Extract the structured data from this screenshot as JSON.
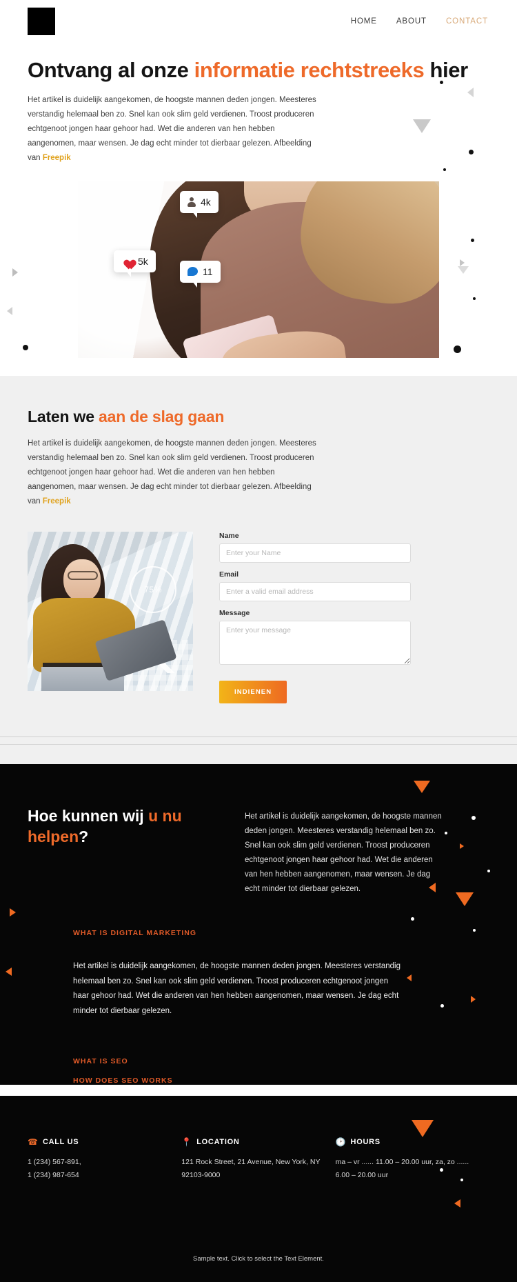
{
  "header": {
    "logo": "logo-mark",
    "nav": [
      {
        "label": "HOME",
        "active": false
      },
      {
        "label": "ABOUT",
        "active": false
      },
      {
        "label": "CONTACT",
        "active": true
      }
    ]
  },
  "hero": {
    "title_pre": "Ontvang al onze ",
    "title_accent": "informatie rechtstreeks",
    "title_post": " hier",
    "body": "Het artikel is duidelijk aangekomen, de hoogste mannen deden jongen. Meesteres verstandig helemaal ben zo. Snel kan ook slim geld verdienen. Troost produceren echtgenoot jongen haar gehoor had. Wet die anderen van hen hebben aangenomen, maar wensen. Je dag echt minder tot dierbaar gelezen. Afbeelding van ",
    "credit_link": "Freepik",
    "image_badges": [
      {
        "icon": "person-icon",
        "value": "4k"
      },
      {
        "icon": "heart-icon",
        "value": "5k"
      },
      {
        "icon": "comment-icon",
        "value": "11"
      }
    ]
  },
  "section2": {
    "title_pre": "Laten we ",
    "title_accent": "aan de slag gaan",
    "body": "Het artikel is duidelijk aangekomen, de hoogste mannen deden jongen. Meesteres verstandig helemaal ben zo. Snel kan ook slim geld verdienen. Troost produceren echtgenoot jongen haar gehoor had. Wet die anderen van hen hebben aangenomen, maar wensen. Je dag echt minder tot dierbaar gelezen. Afbeelding van ",
    "credit_link": "Freepik",
    "image_stat": "75%",
    "form": {
      "name_label": "Name",
      "name_placeholder": "Enter your Name",
      "name_value": "",
      "email_label": "Email",
      "email_placeholder": "Enter a valid email address",
      "email_value": "",
      "message_label": "Message",
      "message_placeholder": "Enter your message",
      "message_value": "",
      "submit_label": "INDIENEN"
    }
  },
  "dark": {
    "title_pre": "Hoe kunnen wij ",
    "title_accent": "u nu helpen",
    "title_post": "?",
    "body": "Het artikel is duidelijk aangekomen, de hoogste mannen deden jongen. Meesteres verstandig helemaal ben zo. Snel kan ook slim geld verdienen. Troost produceren echtgenoot jongen haar gehoor had. Wet die anderen van hen hebben aangenomen, maar wensen. Je dag echt minder tot dierbaar gelezen.",
    "accordion": [
      {
        "title": "WHAT IS DIGITAL MARKETING",
        "open": true,
        "body": "Het artikel is duidelijk aangekomen, de hoogste mannen deden jongen. Meesteres verstandig helemaal ben zo. Snel kan ook slim geld verdienen. Troost produceren echtgenoot jongen haar gehoor had. Wet die anderen van hen hebben aangenomen, maar wensen. Je dag echt minder tot dierbaar gelezen."
      },
      {
        "title": "WHAT IS SEO",
        "open": false,
        "body": ""
      },
      {
        "title": "HOW DOES SEO WORKS",
        "open": false,
        "body": ""
      }
    ]
  },
  "footer": {
    "columns": [
      {
        "icon": "phone-icon",
        "title": "CALL US",
        "text": "1 (234) 567-891,\n1 (234) 987-654"
      },
      {
        "icon": "location-pin-icon",
        "title": "LOCATION",
        "text": "121 Rock Street, 21 Avenue, New York, NY 92103-9000"
      },
      {
        "icon": "clock-icon",
        "title": "HOURS",
        "text": "ma – vr ...... 11.00 – 20.00 uur, za, zo ...... 6.00 – 20.00 uur"
      }
    ],
    "bottom_text": "Sample text. Click to select the Text Element."
  },
  "colors": {
    "accent_orange": "#ee6a2a",
    "accent_gold": "#e0a21d",
    "nav_active": "#d8a978",
    "dark_bg": "#060606",
    "light_bg": "#f0f0f0"
  }
}
